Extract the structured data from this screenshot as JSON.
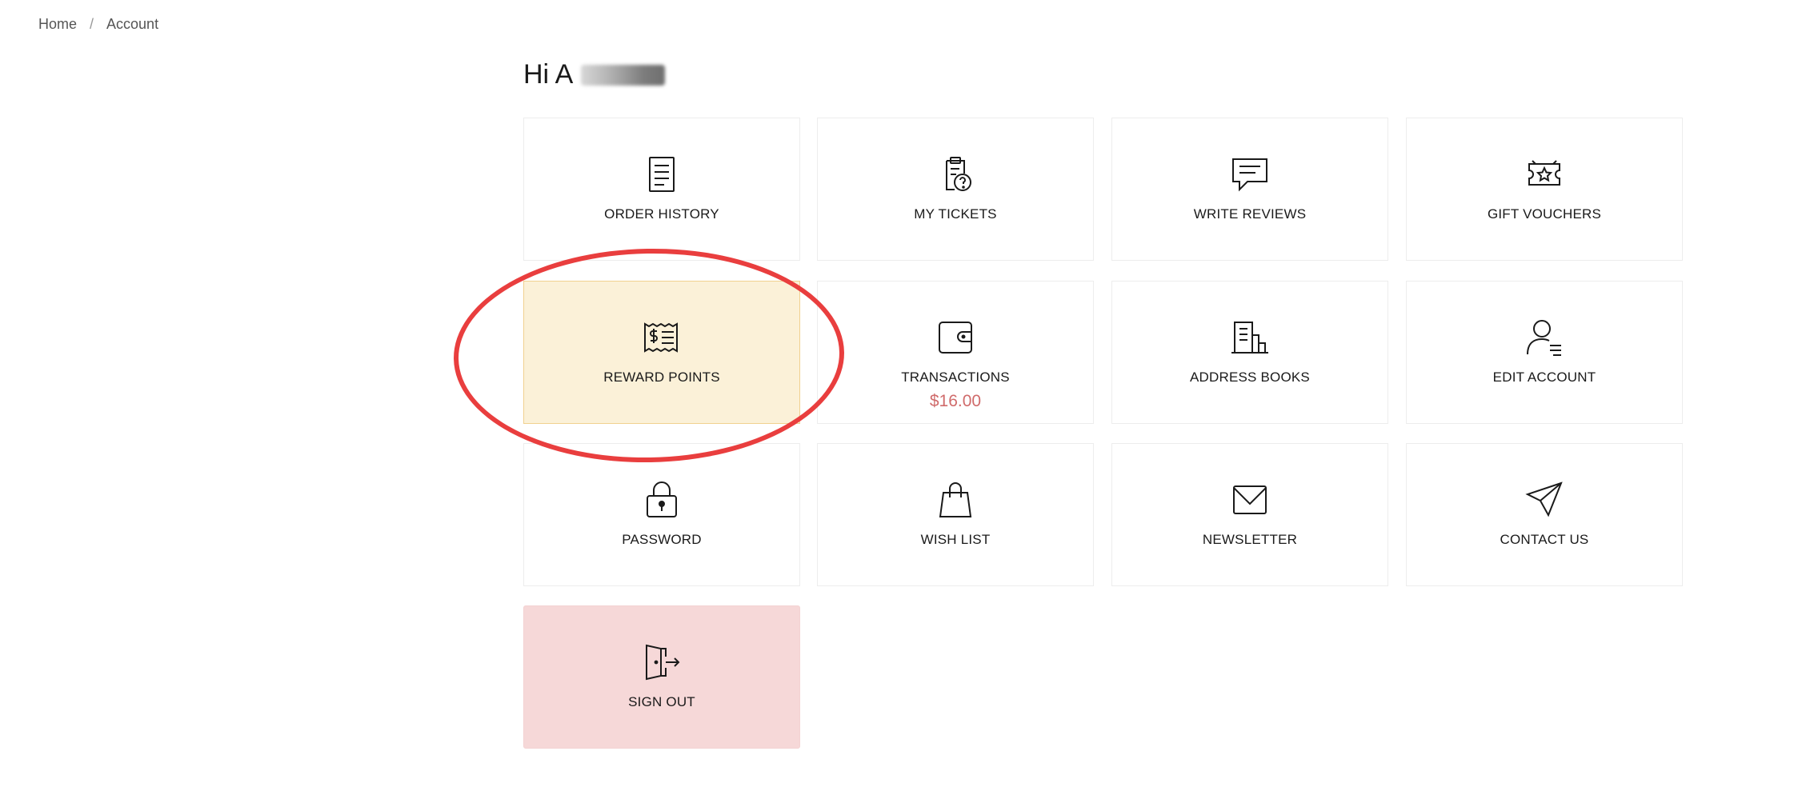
{
  "breadcrumb": {
    "home": "Home",
    "separator": "/",
    "current": "Account"
  },
  "greeting": {
    "text": "Hi A"
  },
  "tiles": [
    {
      "label": "ORDER HISTORY",
      "icon": "document-list-icon"
    },
    {
      "label": "MY TICKETS",
      "icon": "clipboard-question-icon"
    },
    {
      "label": "WRITE REVIEWS",
      "icon": "chat-bubble-icon"
    },
    {
      "label": "GIFT VOUCHERS",
      "icon": "voucher-star-icon"
    },
    {
      "label": "REWARD POINTS",
      "icon": "receipt-dollar-icon"
    },
    {
      "label": "TRANSACTIONS",
      "icon": "wallet-icon",
      "amount": "$16.00"
    },
    {
      "label": "ADDRESS BOOKS",
      "icon": "building-icon"
    },
    {
      "label": "EDIT ACCOUNT",
      "icon": "user-edit-icon"
    },
    {
      "label": "PASSWORD",
      "icon": "padlock-icon"
    },
    {
      "label": "WISH LIST",
      "icon": "shopping-bag-icon"
    },
    {
      "label": "NEWSLETTER",
      "icon": "envelope-icon"
    },
    {
      "label": "CONTACT US",
      "icon": "paper-plane-icon"
    },
    {
      "label": "SIGN OUT",
      "icon": "exit-door-icon"
    }
  ],
  "colors": {
    "highlight_bg": "#fbf1d8",
    "signout_bg": "#f6d8d8",
    "amount_color": "#d06b6b",
    "annotation_red": "#e93e3e"
  }
}
